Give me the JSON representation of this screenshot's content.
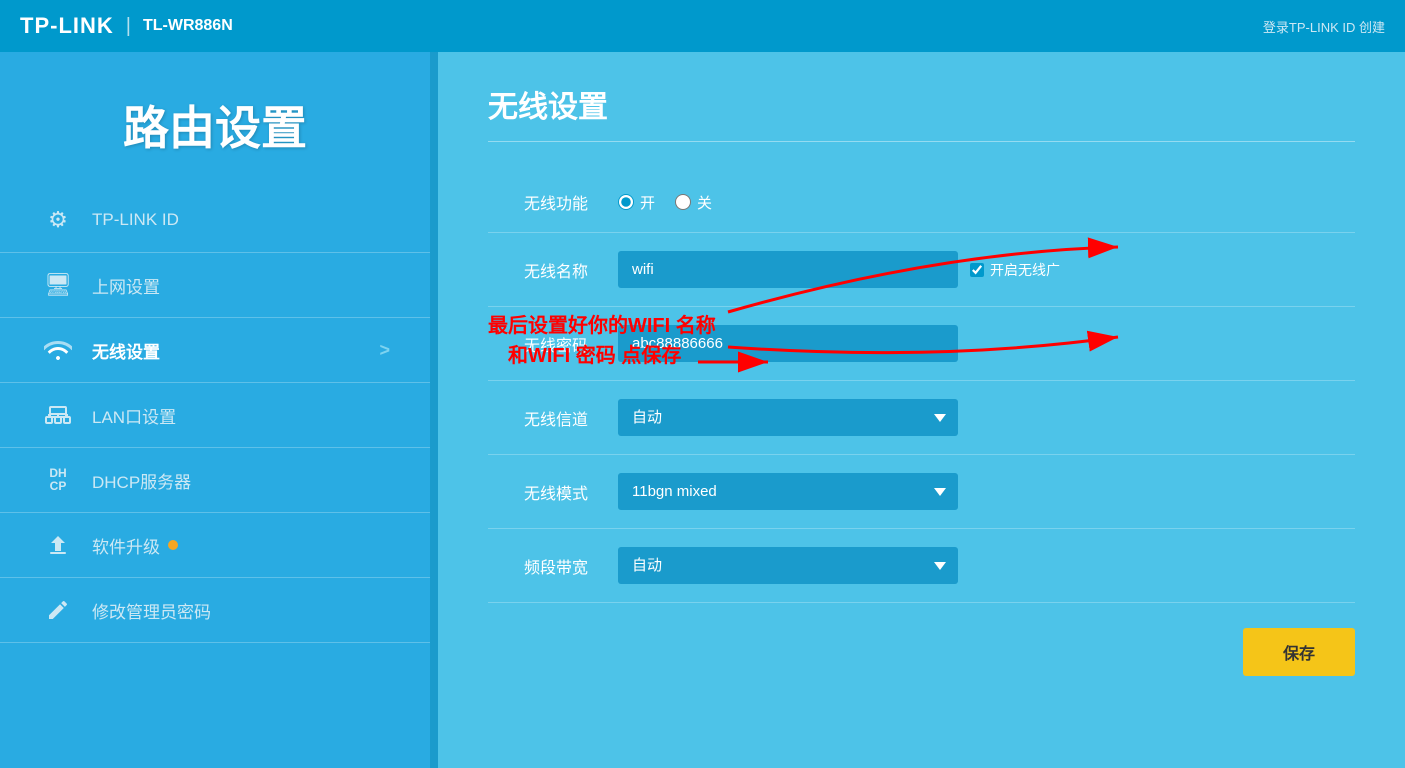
{
  "header": {
    "brand": "TP-LINK",
    "divider": "|",
    "model": "TL-WR886N",
    "links": "登录TP-LINK ID  创建"
  },
  "sidebar": {
    "title": "路由设置",
    "items": [
      {
        "id": "tplink-id",
        "icon": "⚙",
        "label": "TP-LINK ID",
        "active": false,
        "badge": false,
        "arrow": false
      },
      {
        "id": "internet",
        "icon": "🖥",
        "label": "上网设置",
        "active": false,
        "badge": false,
        "arrow": false
      },
      {
        "id": "wireless",
        "icon": "📶",
        "label": "无线设置",
        "active": true,
        "badge": false,
        "arrow": true
      },
      {
        "id": "lan",
        "icon": "🌐",
        "label": "LAN口设置",
        "active": false,
        "badge": false,
        "arrow": false
      },
      {
        "id": "dhcp",
        "icon": "DH\nCP",
        "label": "DHCP服务器",
        "active": false,
        "badge": false,
        "arrow": false
      },
      {
        "id": "upgrade",
        "icon": "⬆",
        "label": "软件升级",
        "active": false,
        "badge": true,
        "arrow": false
      },
      {
        "id": "password",
        "icon": "✏",
        "label": "修改管理员密码",
        "active": false,
        "badge": false,
        "arrow": false
      }
    ]
  },
  "content": {
    "title": "无线设置",
    "form": {
      "wifi_enable_label": "无线功能",
      "wifi_enable_on": "开",
      "wifi_enable_off": "关",
      "wifi_name_label": "无线名称",
      "wifi_name_value": "wifi",
      "wifi_name_placeholder": "wifi",
      "broadcast_label": "开启无线广",
      "wifi_password_label": "无线密码",
      "wifi_password_value": "abc88886666",
      "wifi_channel_label": "无线信道",
      "wifi_channel_value": "自动",
      "wifi_mode_label": "无线模式",
      "wifi_mode_value": "11bgn mixed",
      "wifi_bandwidth_label": "频段带宽",
      "wifi_bandwidth_value": "自动",
      "save_button": "保存"
    },
    "annotation": {
      "text_line1": "最后设置好你的WIFI 名称",
      "text_line2": "和WIFI  密码  点保存"
    }
  }
}
